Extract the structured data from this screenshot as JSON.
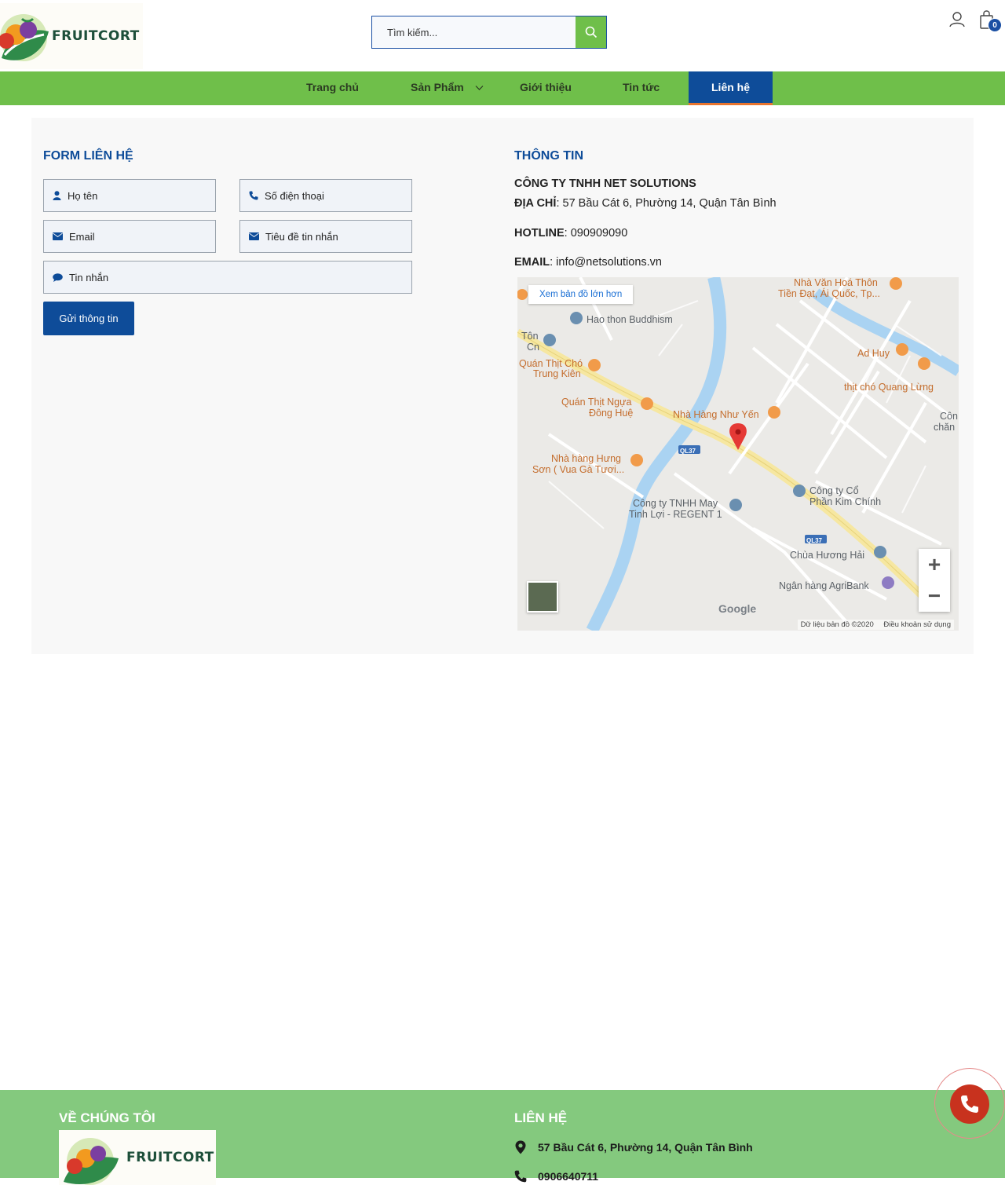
{
  "header": {
    "brand": "FRUITCORT",
    "search_placeholder": "Tìm kiếm...",
    "cart_count": "0"
  },
  "nav": {
    "items": [
      "Trang chủ",
      "Sản Phẩm",
      "Giới thiệu",
      "Tin tức",
      "Liên hệ"
    ],
    "active": "Liên hệ"
  },
  "form": {
    "title": "FORM LIÊN HỆ",
    "name_placeholder": "Họ tên",
    "phone_placeholder": "Số điện thoại",
    "email_placeholder": "Email",
    "subject_placeholder": "Tiêu đề tin nhắn",
    "message_placeholder": "Tin nhắn",
    "submit_label": "Gửi thông tin"
  },
  "info": {
    "title": "THÔNG TIN",
    "company": "CÔNG TY TNHH NET SOLUTIONS",
    "address_label": "ĐỊA CHỈ",
    "address": "57 Bầu Cát 6, Phường 14, Quận Tân Bình",
    "hotline_label": "HOTLINE",
    "hotline": "090909090",
    "email_label": "EMAIL",
    "email": "info@netsolutions.vn"
  },
  "map": {
    "bigger_map": "Xem bản đồ lớn hơn",
    "labels": {
      "hao_thon": "Hao thon Buddhism",
      "ton_cn_1": "Tôn",
      "ton_cn_2": "Cn",
      "quan_thit_cho_1": "Quán Thịt Chó",
      "quan_thit_cho_2": "Trung Kiên",
      "nha_van_hoa_1": "Nhà Văn Hoá Thôn",
      "nha_van_hoa_2": "Tiền Đạt, Ái Quốc, Tp...",
      "ad_huy": "Ad Huy",
      "thit_cho_quang": "thịt chó Quang Lừng",
      "con_chan_1": "Côn",
      "con_chan_2": "chăn",
      "quan_thit_ngua_1": "Quán Thịt Ngựa",
      "quan_thit_ngua_2": "Đông Huệ",
      "nha_hang_nhu_yen": "Nhà Hàng Như Yến",
      "ql37_a": "QL37",
      "ql37_b": "QL37",
      "nha_hang_hung_1": "Nhà hàng Hưng",
      "nha_hang_hung_2": "Sơn ( Vua Gà Tươi...",
      "cong_ty_may_1": "Công ty TNHH May",
      "cong_ty_may_2": "Tinh Lợi - REGENT 1",
      "cong_ty_co_1": "Công ty Cổ",
      "cong_ty_co_2": "Phần Kim Chính",
      "chua_huong_hai": "Chùa Hương Hải",
      "ngan_hang": "Ngân hàng AgriBank"
    },
    "google": "Google",
    "map_data": "Dữ liệu bản đồ ©2020",
    "terms": "Điều khoản sử dụng",
    "zoom_in": "+",
    "zoom_out": "−"
  },
  "footer": {
    "about_title": "VỀ CHÚNG TÔI",
    "contact_title": "LIÊN HỆ",
    "brand": "FRUITCORT",
    "address": "57 Bầu Cát 6, Phường 14, Quận Tân Bình",
    "phone": "0906640711"
  },
  "colors": {
    "primary_blue": "#0e4c99",
    "nav_green": "#6fbf4a",
    "footer_green": "#84c97e",
    "active_underline": "#e8742e",
    "call_red": "#c8321e"
  },
  "icons": [
    "search-icon",
    "user-icon",
    "cart-icon",
    "chevron-down-icon",
    "user-solid-icon",
    "phone-icon",
    "envelope-icon",
    "comment-icon",
    "location-pin-icon",
    "call-icon"
  ]
}
